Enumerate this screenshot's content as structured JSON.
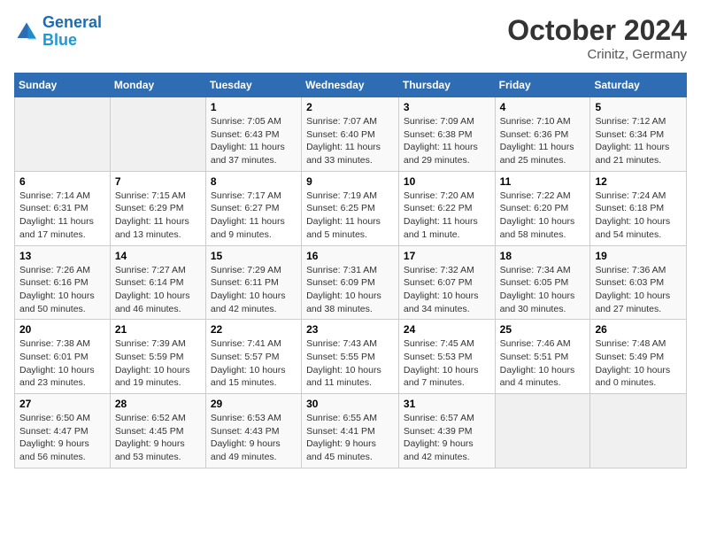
{
  "header": {
    "logo_line1": "General",
    "logo_line2": "Blue",
    "month": "October 2024",
    "location": "Crinitz, Germany"
  },
  "days_of_week": [
    "Sunday",
    "Monday",
    "Tuesday",
    "Wednesday",
    "Thursday",
    "Friday",
    "Saturday"
  ],
  "weeks": [
    [
      {
        "day": "",
        "info": ""
      },
      {
        "day": "",
        "info": ""
      },
      {
        "day": "1",
        "info": "Sunrise: 7:05 AM\nSunset: 6:43 PM\nDaylight: 11 hours and 37 minutes."
      },
      {
        "day": "2",
        "info": "Sunrise: 7:07 AM\nSunset: 6:40 PM\nDaylight: 11 hours and 33 minutes."
      },
      {
        "day": "3",
        "info": "Sunrise: 7:09 AM\nSunset: 6:38 PM\nDaylight: 11 hours and 29 minutes."
      },
      {
        "day": "4",
        "info": "Sunrise: 7:10 AM\nSunset: 6:36 PM\nDaylight: 11 hours and 25 minutes."
      },
      {
        "day": "5",
        "info": "Sunrise: 7:12 AM\nSunset: 6:34 PM\nDaylight: 11 hours and 21 minutes."
      }
    ],
    [
      {
        "day": "6",
        "info": "Sunrise: 7:14 AM\nSunset: 6:31 PM\nDaylight: 11 hours and 17 minutes."
      },
      {
        "day": "7",
        "info": "Sunrise: 7:15 AM\nSunset: 6:29 PM\nDaylight: 11 hours and 13 minutes."
      },
      {
        "day": "8",
        "info": "Sunrise: 7:17 AM\nSunset: 6:27 PM\nDaylight: 11 hours and 9 minutes."
      },
      {
        "day": "9",
        "info": "Sunrise: 7:19 AM\nSunset: 6:25 PM\nDaylight: 11 hours and 5 minutes."
      },
      {
        "day": "10",
        "info": "Sunrise: 7:20 AM\nSunset: 6:22 PM\nDaylight: 11 hours and 1 minute."
      },
      {
        "day": "11",
        "info": "Sunrise: 7:22 AM\nSunset: 6:20 PM\nDaylight: 10 hours and 58 minutes."
      },
      {
        "day": "12",
        "info": "Sunrise: 7:24 AM\nSunset: 6:18 PM\nDaylight: 10 hours and 54 minutes."
      }
    ],
    [
      {
        "day": "13",
        "info": "Sunrise: 7:26 AM\nSunset: 6:16 PM\nDaylight: 10 hours and 50 minutes."
      },
      {
        "day": "14",
        "info": "Sunrise: 7:27 AM\nSunset: 6:14 PM\nDaylight: 10 hours and 46 minutes."
      },
      {
        "day": "15",
        "info": "Sunrise: 7:29 AM\nSunset: 6:11 PM\nDaylight: 10 hours and 42 minutes."
      },
      {
        "day": "16",
        "info": "Sunrise: 7:31 AM\nSunset: 6:09 PM\nDaylight: 10 hours and 38 minutes."
      },
      {
        "day": "17",
        "info": "Sunrise: 7:32 AM\nSunset: 6:07 PM\nDaylight: 10 hours and 34 minutes."
      },
      {
        "day": "18",
        "info": "Sunrise: 7:34 AM\nSunset: 6:05 PM\nDaylight: 10 hours and 30 minutes."
      },
      {
        "day": "19",
        "info": "Sunrise: 7:36 AM\nSunset: 6:03 PM\nDaylight: 10 hours and 27 minutes."
      }
    ],
    [
      {
        "day": "20",
        "info": "Sunrise: 7:38 AM\nSunset: 6:01 PM\nDaylight: 10 hours and 23 minutes."
      },
      {
        "day": "21",
        "info": "Sunrise: 7:39 AM\nSunset: 5:59 PM\nDaylight: 10 hours and 19 minutes."
      },
      {
        "day": "22",
        "info": "Sunrise: 7:41 AM\nSunset: 5:57 PM\nDaylight: 10 hours and 15 minutes."
      },
      {
        "day": "23",
        "info": "Sunrise: 7:43 AM\nSunset: 5:55 PM\nDaylight: 10 hours and 11 minutes."
      },
      {
        "day": "24",
        "info": "Sunrise: 7:45 AM\nSunset: 5:53 PM\nDaylight: 10 hours and 7 minutes."
      },
      {
        "day": "25",
        "info": "Sunrise: 7:46 AM\nSunset: 5:51 PM\nDaylight: 10 hours and 4 minutes."
      },
      {
        "day": "26",
        "info": "Sunrise: 7:48 AM\nSunset: 5:49 PM\nDaylight: 10 hours and 0 minutes."
      }
    ],
    [
      {
        "day": "27",
        "info": "Sunrise: 6:50 AM\nSunset: 4:47 PM\nDaylight: 9 hours and 56 minutes."
      },
      {
        "day": "28",
        "info": "Sunrise: 6:52 AM\nSunset: 4:45 PM\nDaylight: 9 hours and 53 minutes."
      },
      {
        "day": "29",
        "info": "Sunrise: 6:53 AM\nSunset: 4:43 PM\nDaylight: 9 hours and 49 minutes."
      },
      {
        "day": "30",
        "info": "Sunrise: 6:55 AM\nSunset: 4:41 PM\nDaylight: 9 hours and 45 minutes."
      },
      {
        "day": "31",
        "info": "Sunrise: 6:57 AM\nSunset: 4:39 PM\nDaylight: 9 hours and 42 minutes."
      },
      {
        "day": "",
        "info": ""
      },
      {
        "day": "",
        "info": ""
      }
    ]
  ]
}
